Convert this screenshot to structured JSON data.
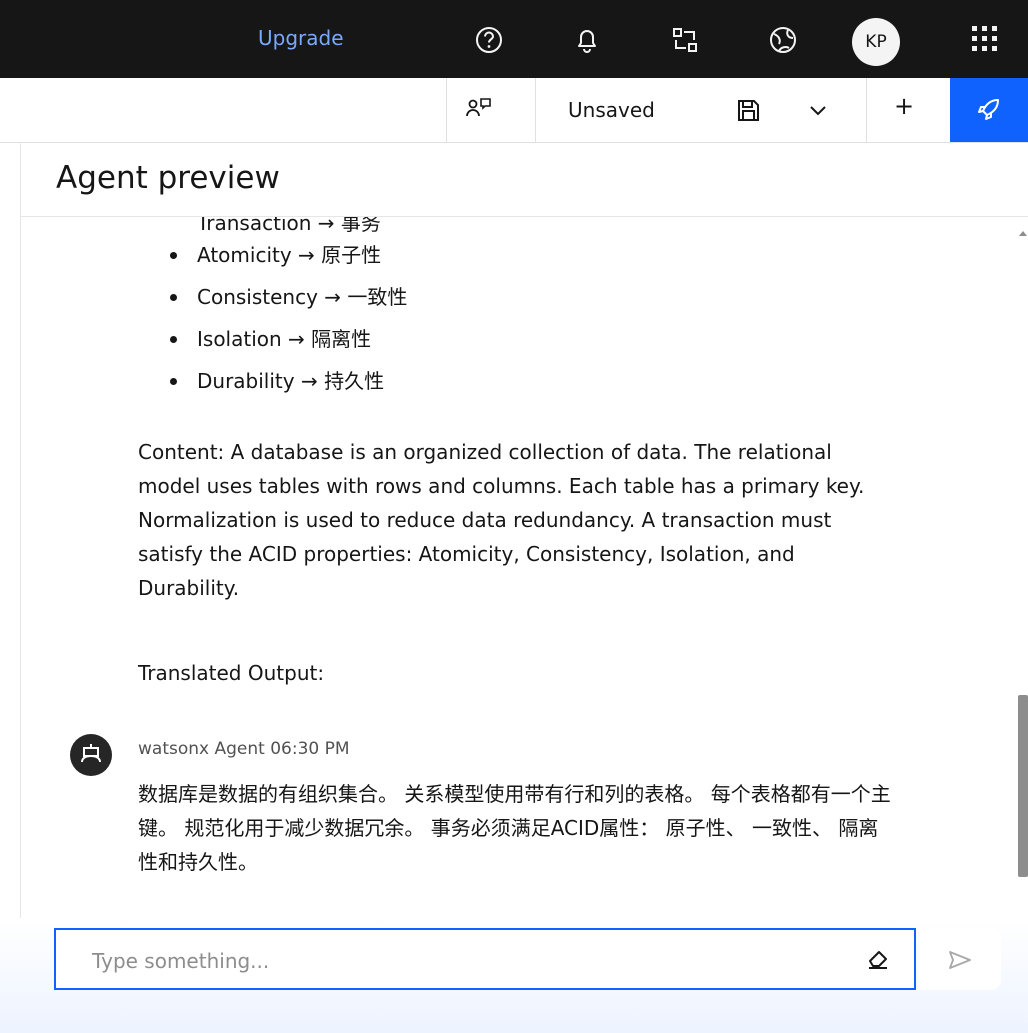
{
  "header": {
    "upgrade_label": "Upgrade",
    "avatar_initials": "KP"
  },
  "toolbar": {
    "status": "Unsaved",
    "add_label": "+"
  },
  "panel": {
    "title": "Agent preview"
  },
  "conversation": {
    "partial_line": "Transaction → 事务",
    "bullets": [
      "Atomicity → 原子性",
      "Consistency → 一致性",
      "Isolation → 隔离性",
      "Durability → 持久性"
    ],
    "content_paragraph": "Content: A database is an organized collection of data. The relational model uses tables with rows and columns. Each table has a primary key. Normalization is used to reduce data redundancy. A transaction must satisfy the ACID properties: Atomicity, Consistency, Isolation, and Durability.",
    "translated_label": "Translated Output:",
    "agent_name_time": "watsonx Agent 06:30 PM",
    "agent_message": "数据库是数据的有组织集合。 关系模型使用带有行和列的表格。 每个表格都有一个主键。 规范化用于减少数据冗余。 事务必须满足ACID属性： 原子性、 一致性、 隔离性和持久性。"
  },
  "composer": {
    "placeholder": "Type something..."
  },
  "colors": {
    "topbar": "#161616",
    "accent": "#0f62fe",
    "link": "#78a9ff"
  }
}
